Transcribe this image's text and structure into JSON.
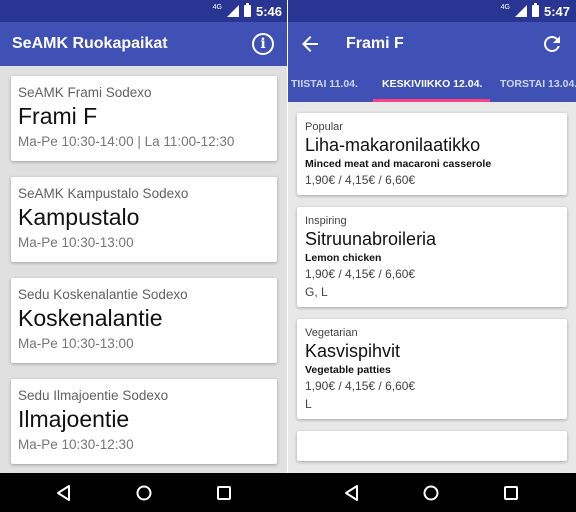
{
  "status": {
    "network": "4G",
    "left_time": "5:46",
    "right_time": "5:47"
  },
  "left": {
    "app_title": "SeAMK Ruokapaikat",
    "info_icon": "info-icon",
    "restaurants": [
      {
        "subtitle": "SeAMK Frami Sodexo",
        "name": "Frami F",
        "hours": "Ma-Pe 10:30-14:00 | La 11:00-12:30"
      },
      {
        "subtitle": "SeAMK Kampustalo Sodexo",
        "name": "Kampustalo",
        "hours": "Ma-Pe 10:30-13:00"
      },
      {
        "subtitle": "Sedu Koskenalantie Sodexo",
        "name": "Koskenalantie",
        "hours": "Ma-Pe 10:30-13:00"
      },
      {
        "subtitle": "Sedu Ilmajoentie Sodexo",
        "name": "Ilmajoentie",
        "hours": "Ma-Pe 10:30-12:30"
      }
    ]
  },
  "right": {
    "title": "Frami F",
    "tabs": [
      "TIISTAI 11.04.",
      "KESKIVIIKKO 12.04.",
      "TORSTAI 13.04."
    ],
    "active_tab": 1,
    "dishes": [
      {
        "category": "Popular",
        "name": "Liha-makaronilaatikko",
        "english": "Minced meat and macaroni casserole",
        "price": "1,90€ / 4,15€ / 6,60€",
        "diet": ""
      },
      {
        "category": "Inspiring",
        "name": "Sitruunabroileria",
        "english": "Lemon chicken",
        "price": "1,90€ / 4,15€ / 6,60€",
        "diet": "G, L"
      },
      {
        "category": "Vegetarian",
        "name": "Kasvispihvit",
        "english": "Vegetable patties",
        "price": "1,90€ / 4,15€ / 6,60€",
        "diet": "L"
      }
    ]
  },
  "colors": {
    "primary": "#3f51b5",
    "status": "#283593",
    "accent": "#ff4081"
  },
  "nav_icons": [
    "nav-back-icon",
    "nav-home-icon",
    "nav-recent-icon"
  ]
}
